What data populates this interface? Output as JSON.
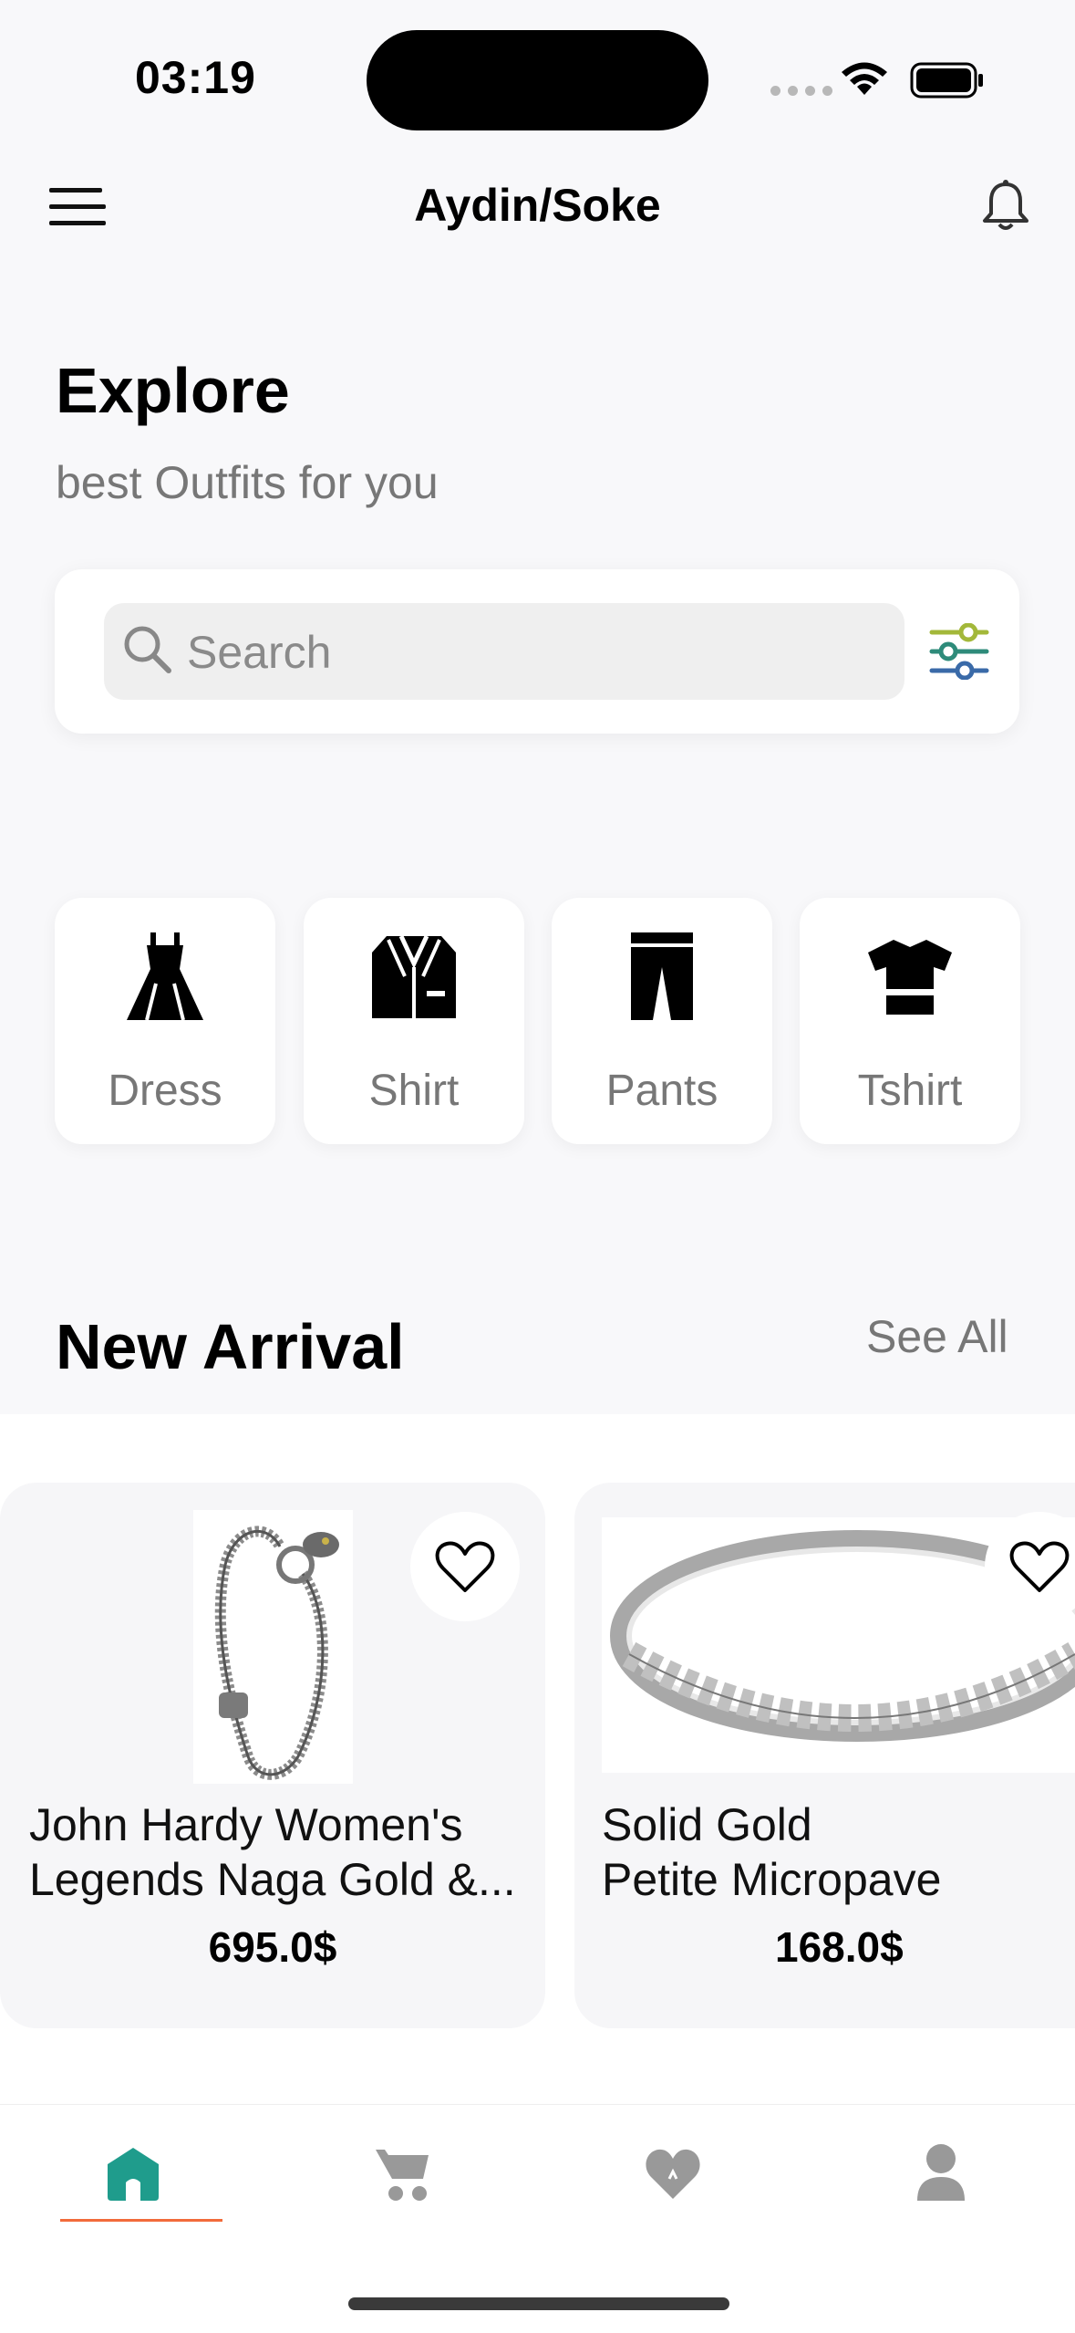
{
  "status_bar": {
    "time": "03:19"
  },
  "header": {
    "location": "Aydin/Soke"
  },
  "hero": {
    "title": "Explore",
    "subtitle": "best Outfits for you"
  },
  "search": {
    "placeholder": "Search"
  },
  "categories": [
    {
      "label": "Dress",
      "icon": "dress-icon"
    },
    {
      "label": "Shirt",
      "icon": "shirt-icon"
    },
    {
      "label": "Pants",
      "icon": "pants-icon"
    },
    {
      "label": "Tshirt",
      "icon": "tshirt-icon"
    }
  ],
  "new_arrival": {
    "title": "New Arrival",
    "see_all": "See All",
    "products": [
      {
        "name_line1": "John Hardy Women's",
        "name_line2": "Legends Naga Gold &...",
        "price": "695.0$",
        "image": "bracelet-image"
      },
      {
        "name_line1": "Solid Gold",
        "name_line2": "Petite Micropave",
        "price": "168.0$",
        "image": "ring-image"
      }
    ]
  },
  "tabbar": {
    "active": "home",
    "tabs": [
      "home-icon",
      "cart-icon",
      "favorites-icon",
      "profile-icon"
    ]
  },
  "colors": {
    "accent": "#f26b3a",
    "home_icon": "#1f9c8c",
    "background": "#f8f8fa"
  }
}
